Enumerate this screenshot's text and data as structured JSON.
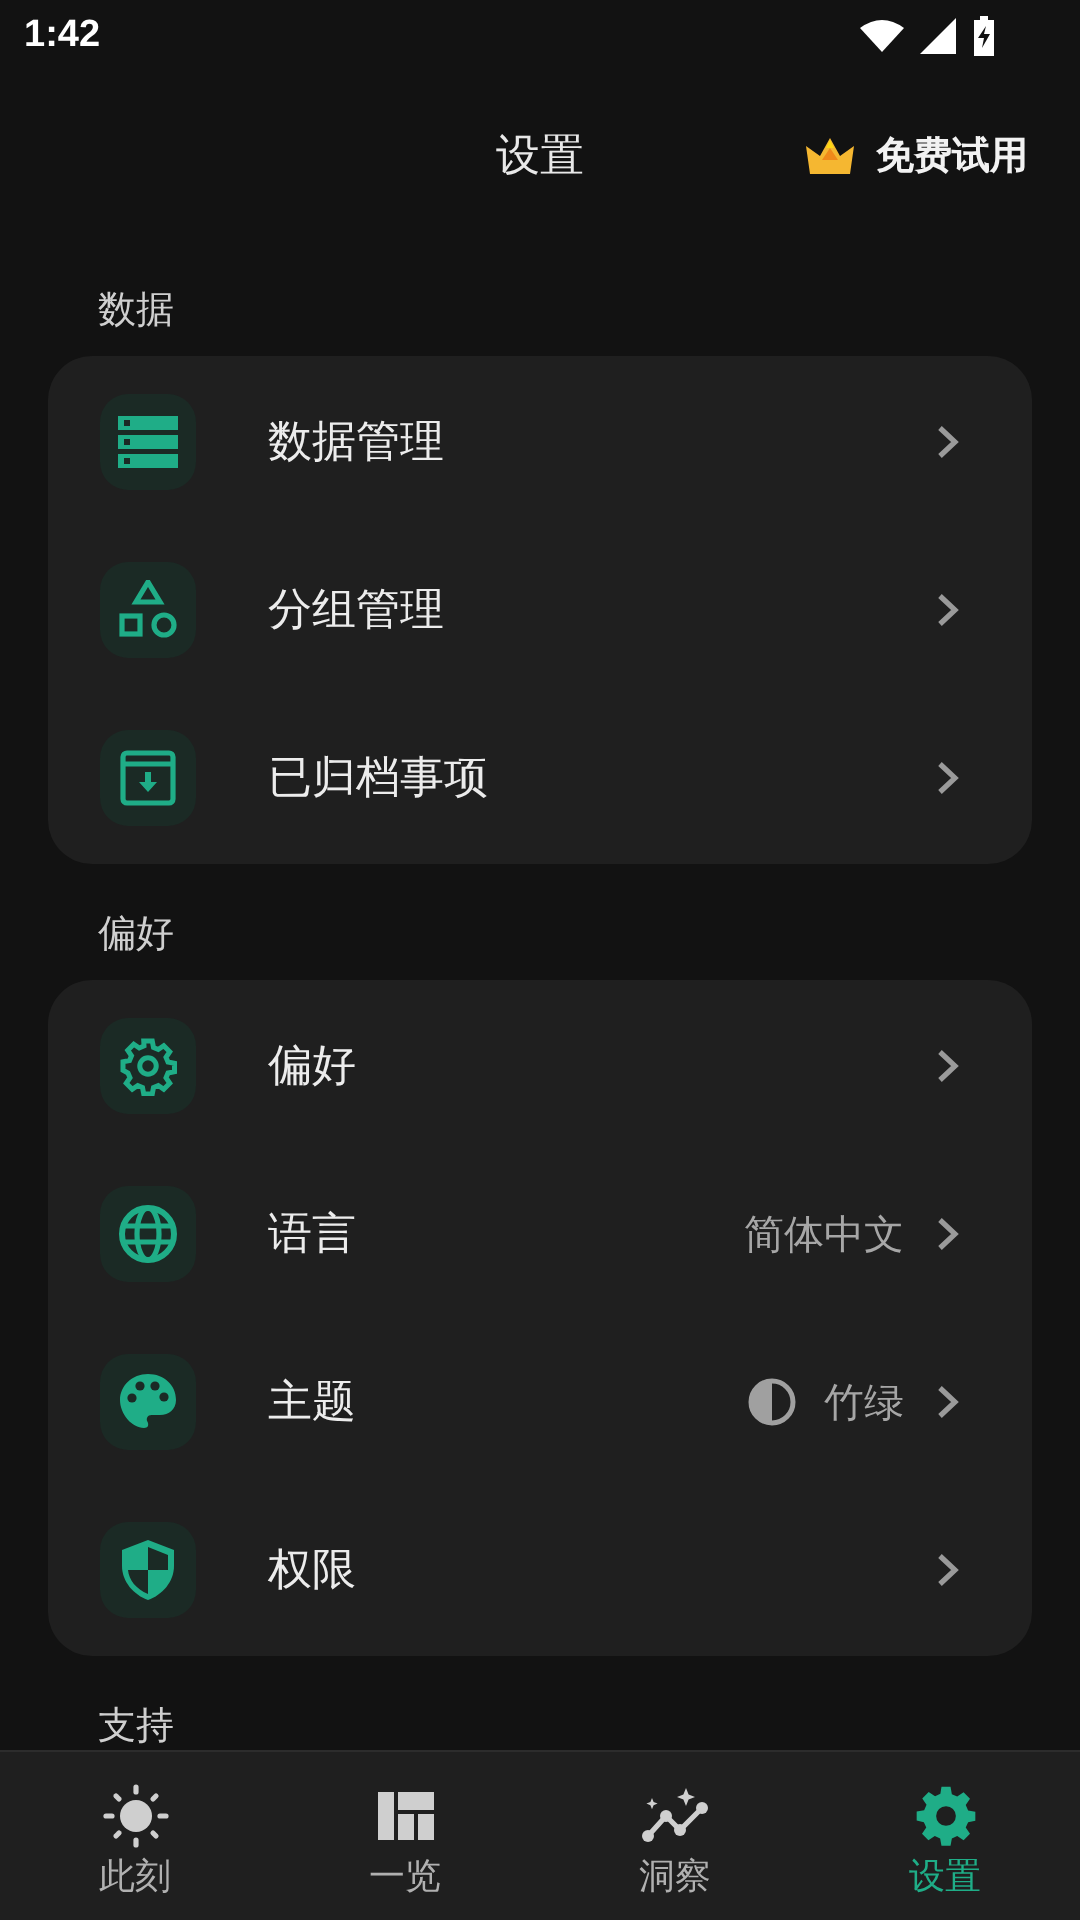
{
  "status_bar": {
    "time": "1:42"
  },
  "header": {
    "title": "设置",
    "trial": "免费试用"
  },
  "sections": [
    {
      "title": "数据",
      "items": [
        {
          "label": "数据管理",
          "kind": "link"
        },
        {
          "label": "分组管理",
          "kind": "link"
        },
        {
          "label": "已归档事项",
          "kind": "link"
        }
      ]
    },
    {
      "title": "偏好",
      "items": [
        {
          "label": "偏好",
          "kind": "link"
        },
        {
          "label": "语言",
          "kind": "value",
          "value": "简体中文"
        },
        {
          "label": "主题",
          "kind": "theme",
          "value": "竹绿"
        },
        {
          "label": "权限",
          "kind": "link"
        }
      ]
    },
    {
      "title": "支持"
    }
  ],
  "bottom_nav": [
    {
      "label": "此刻",
      "selected": false
    },
    {
      "label": "一览",
      "selected": false
    },
    {
      "label": "洞察",
      "selected": false
    },
    {
      "label": "设置",
      "selected": true
    }
  ]
}
